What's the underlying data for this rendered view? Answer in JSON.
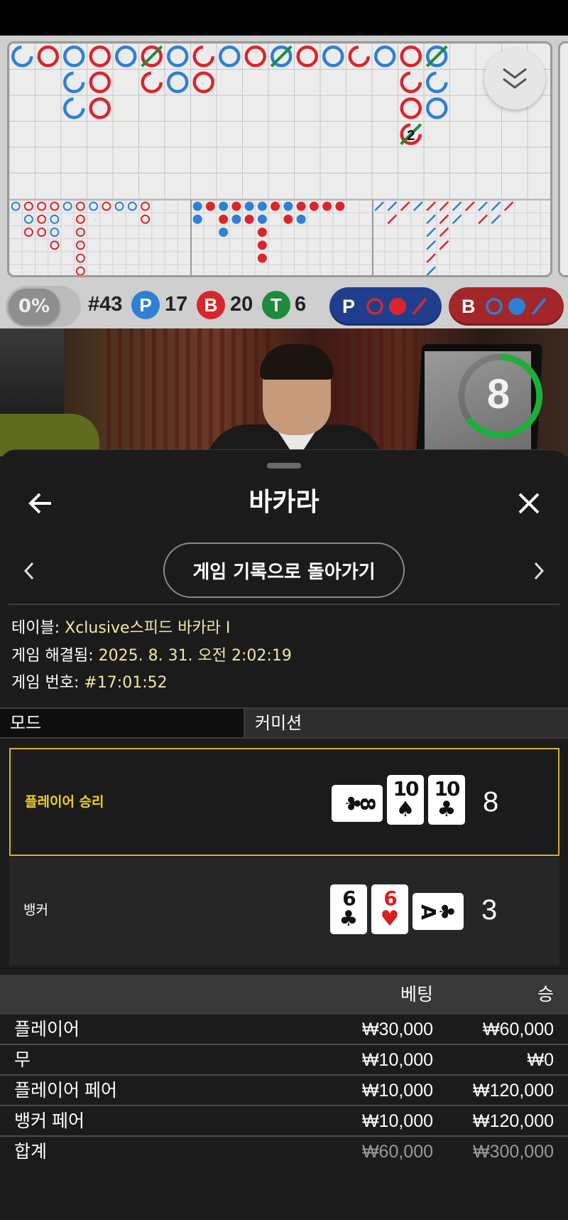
{
  "roadmap": {
    "big_road": [
      {
        "c": 0,
        "r": 0,
        "t": "P",
        "ring": "half"
      },
      {
        "c": 1,
        "r": 0,
        "t": "B"
      },
      {
        "c": 2,
        "r": 0,
        "t": "P"
      },
      {
        "c": 3,
        "r": 0,
        "t": "B"
      },
      {
        "c": 4,
        "r": 0,
        "t": "P"
      },
      {
        "c": 5,
        "r": 0,
        "t": "B",
        "tie": true
      },
      {
        "c": 6,
        "r": 0,
        "t": "P"
      },
      {
        "c": 7,
        "r": 0,
        "t": "B",
        "ring": "half"
      },
      {
        "c": 8,
        "r": 0,
        "t": "P"
      },
      {
        "c": 9,
        "r": 0,
        "t": "B"
      },
      {
        "c": 10,
        "r": 0,
        "t": "P",
        "tie": true
      },
      {
        "c": 11,
        "r": 0,
        "t": "B"
      },
      {
        "c": 12,
        "r": 0,
        "t": "P"
      },
      {
        "c": 13,
        "r": 0,
        "t": "B",
        "ring": "half"
      },
      {
        "c": 14,
        "r": 0,
        "t": "P"
      },
      {
        "c": 15,
        "r": 0,
        "t": "B"
      },
      {
        "c": 16,
        "r": 0,
        "t": "P",
        "tie": true
      },
      {
        "c": 2,
        "r": 1,
        "t": "P",
        "ring": "half"
      },
      {
        "c": 3,
        "r": 1,
        "t": "B"
      },
      {
        "c": 5,
        "r": 1,
        "t": "B",
        "ring": "half"
      },
      {
        "c": 6,
        "r": 1,
        "t": "P"
      },
      {
        "c": 7,
        "r": 1,
        "t": "B"
      },
      {
        "c": 15,
        "r": 1,
        "t": "B",
        "ring": "half"
      },
      {
        "c": 16,
        "r": 1,
        "t": "P",
        "ring": "half"
      },
      {
        "c": 2,
        "r": 2,
        "t": "P",
        "ring": "half"
      },
      {
        "c": 3,
        "r": 2,
        "t": "B"
      },
      {
        "c": 15,
        "r": 2,
        "t": "B"
      },
      {
        "c": 16,
        "r": 2,
        "t": "P"
      },
      {
        "c": 15,
        "r": 3,
        "t": "B",
        "ring": "half",
        "tie": true,
        "label": "2"
      }
    ]
  },
  "stats": {
    "percent": "0%",
    "round": "#43",
    "player_letter": "P",
    "player_count": "17",
    "banker_letter": "B",
    "banker_count": "20",
    "tie_letter": "T",
    "tie_count": "6",
    "predict_player": "P",
    "predict_banker": "B"
  },
  "timer": {
    "value": "8"
  },
  "sheet": {
    "title": "바카라",
    "back_to_history": "게임 기록으로 돌아가기",
    "table_label": "테이블:",
    "table_value": "Xclusive스피드 바카라 I",
    "resolved_label": "게임 해결됨:",
    "resolved_value": "2025. 8. 31. 오전 2:02:19",
    "game_no_label": "게임 번호:",
    "game_no_value": "#17:01:52",
    "tab_mode": "모드",
    "tab_commission": "커미션"
  },
  "hands": {
    "player": {
      "label": "플레이어 승리",
      "score": "8",
      "cards": [
        {
          "rank": "8",
          "suit": "♣",
          "color": "black",
          "orientation": "horizontal"
        },
        {
          "rank": "10",
          "suit": "♠",
          "color": "black",
          "orientation": "vertical"
        },
        {
          "rank": "10",
          "suit": "♣",
          "color": "black",
          "orientation": "vertical"
        }
      ]
    },
    "banker": {
      "label": "뱅커",
      "score": "3",
      "cards": [
        {
          "rank": "6",
          "suit": "♣",
          "color": "black",
          "orientation": "vertical"
        },
        {
          "rank": "6",
          "suit": "♥",
          "color": "red",
          "orientation": "vertical"
        },
        {
          "rank": "A",
          "suit": "♣",
          "color": "black",
          "orientation": "horizontal"
        }
      ]
    }
  },
  "bets": {
    "header": {
      "bet": "베팅",
      "win": "승"
    },
    "rows": [
      {
        "name": "플레이어",
        "bet": "₩30,000",
        "win": "₩60,000"
      },
      {
        "name": "무",
        "bet": "₩10,000",
        "win": "₩0"
      },
      {
        "name": "플레이어 페어",
        "bet": "₩10,000",
        "win": "₩120,000"
      },
      {
        "name": "뱅커 페어",
        "bet": "₩10,000",
        "win": "₩120,000"
      }
    ],
    "total": {
      "name": "합계",
      "bet": "₩60,000",
      "win": "₩300,000"
    }
  },
  "colors": {
    "player": "#2f7fd3",
    "banker": "#d8262c",
    "tie": "#1e8a3c",
    "win_border": "#cdb42a",
    "win_label": "#f2cf1e",
    "info_value": "#f3e6a6"
  }
}
